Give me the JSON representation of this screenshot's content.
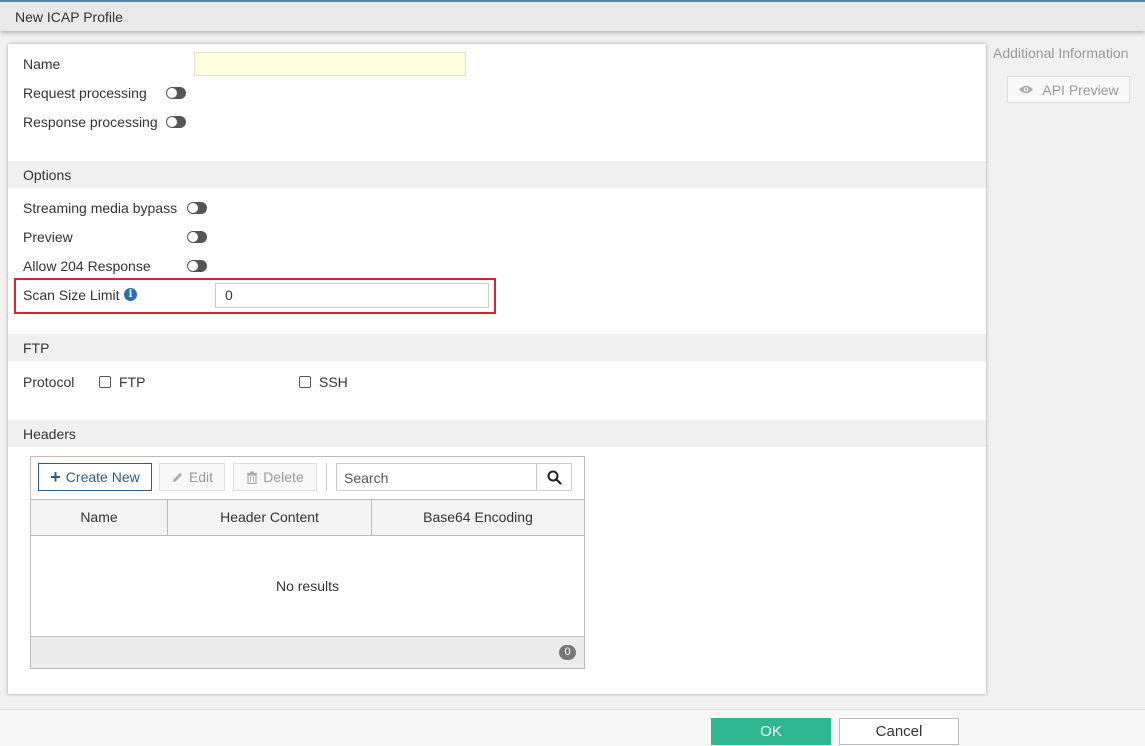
{
  "window": {
    "title": "New ICAP Profile"
  },
  "form": {
    "name_label": "Name",
    "name_value": "",
    "request_processing_label": "Request processing",
    "response_processing_label": "Response processing",
    "request_processing_enabled": false,
    "response_processing_enabled": false
  },
  "options": {
    "section_title": "Options",
    "streaming_label": "Streaming media bypass",
    "preview_label": "Preview",
    "allow204_label": "Allow 204 Response",
    "scan_size_label": "Scan Size Limit",
    "scan_size_value": "0",
    "streaming_enabled": false,
    "preview_enabled": false,
    "allow204_enabled": false
  },
  "ftp": {
    "section_title": "FTP",
    "protocol_label": "Protocol",
    "ftp_option": "FTP",
    "ssh_option": "SSH",
    "ftp_checked": false,
    "ssh_checked": false
  },
  "headers": {
    "section_title": "Headers",
    "create_label": "Create New",
    "edit_label": "Edit",
    "delete_label": "Delete",
    "search_placeholder": "Search",
    "columns": [
      "Name",
      "Header Content",
      "Base64 Encoding"
    ],
    "empty_text": "No results",
    "count": "0"
  },
  "sidebar": {
    "title": "Additional Information",
    "api_preview_label": "API Preview"
  },
  "footer": {
    "ok_label": "OK",
    "cancel_label": "Cancel"
  },
  "colors": {
    "ok_green": "#2fb58f",
    "highlight_red": "#d9252f",
    "info_blue": "#2a6db5",
    "name_field_bg": "#ffffe0"
  }
}
